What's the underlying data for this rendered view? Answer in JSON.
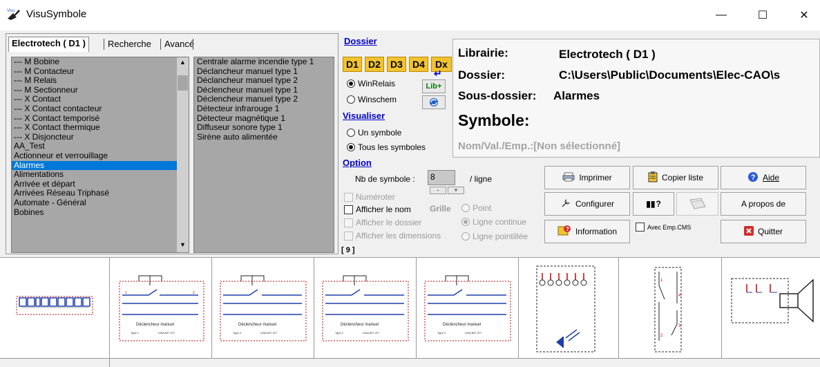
{
  "window": {
    "title": "VisuSymbole",
    "min_label": "—",
    "max_label": "☐",
    "close_label": "✕"
  },
  "tabs": [
    {
      "label": "Electrotech ( D1 )"
    },
    {
      "label": "Recherche"
    },
    {
      "label": "Avancé"
    }
  ],
  "categories": [
    "--- M Bobine",
    "--- M Contacteur",
    "--- M Relais",
    "--- M Sectionneur",
    "--- X Contact",
    "--- X Contact contacteur",
    "--- X Contact temporisé",
    "--- X Contact thermique",
    "--- X Disjoncteur",
    "AA_Test",
    "Actionneur et verrouillage",
    "Alarmes",
    "Alimentations",
    "Arrivée et départ",
    "Arrivées Réseau Triphasé",
    "Automate - Général",
    "Bobines"
  ],
  "selected_category": "Alarmes",
  "symbols": [
    "Centrale alarme incendie type 1",
    "Déclancheur manuel type 1",
    "Déclancheur manuel type 2",
    "Déclencheur manuel type 1",
    "Déclencheur manuel type 2",
    "Détecteur infrarouge 1",
    "Détecteur magnétique 1",
    "Diffuseur sonore type 1",
    "Sirène auto alimentée"
  ],
  "dossier": {
    "header": "Dossier",
    "tabs": [
      "D1",
      "D2",
      "D3",
      "D4",
      "Dx"
    ],
    "radios": [
      {
        "label": "WinRelais",
        "checked": true
      },
      {
        "label": "Winschem",
        "checked": false
      }
    ],
    "lib_plus": "Lib+"
  },
  "visualiser": {
    "header": "Visualiser",
    "radios": [
      {
        "label": "Un symbole",
        "checked": false
      },
      {
        "label": "Tous les symboles",
        "checked": true
      }
    ]
  },
  "option": {
    "header": "Option",
    "nb_label": "Nb de symbole :",
    "nb_value": "8",
    "per_line": "/ ligne",
    "minus": "-",
    "plus": "+",
    "numeroter": "Numéroter",
    "afficher_nom": "Afficher le nom",
    "afficher_dossier": "Afficher le dossier",
    "afficher_dimensions": "Afficher les dimensions",
    "grille": "Grille",
    "point": "Point",
    "ligne_continue": "Ligne continue",
    "ligne_pointillee": "Ligne pointillée",
    "count": "[ 9 ]"
  },
  "info": {
    "librairie_label": "Librairie:",
    "librairie_value": "Electrotech ( D1 )",
    "dossier_label": "Dossier:",
    "dossier_value": "C:\\Users\\Public\\Documents\\Elec-CAO\\s",
    "sousdossier_label": "Sous-dossier:",
    "sousdossier_value": "Alarmes",
    "symbole_label": "Symbole:",
    "nom_label": "Nom/Val./Emp.:[Non sélectionné]"
  },
  "buttons": {
    "imprimer": "Imprimer",
    "copier_liste": "Copier liste",
    "aide": "Aide",
    "configurer": "Configurer",
    "help_q": "?",
    "a_propos": "A propos de",
    "information": "Information",
    "avec_emp": "Avec Emp.CMS",
    "quitter": "Quitter"
  },
  "thumb_text": {
    "declencheur": "Déclencheur manuel",
    "type1": "Type 1",
    "type2": "Type 2",
    "lina": "LINA   837 377"
  },
  "colors": {
    "selection": "#0078d7",
    "link": "#0000cc",
    "folder_tab": "#f1c232",
    "symbol_red": "#cc0000",
    "symbol_blue": "#1f3fa8"
  },
  "icons": [
    "app-icon",
    "printer-icon",
    "clipboard-icon",
    "help-icon",
    "config-icon",
    "info-icon",
    "quit-icon"
  ]
}
